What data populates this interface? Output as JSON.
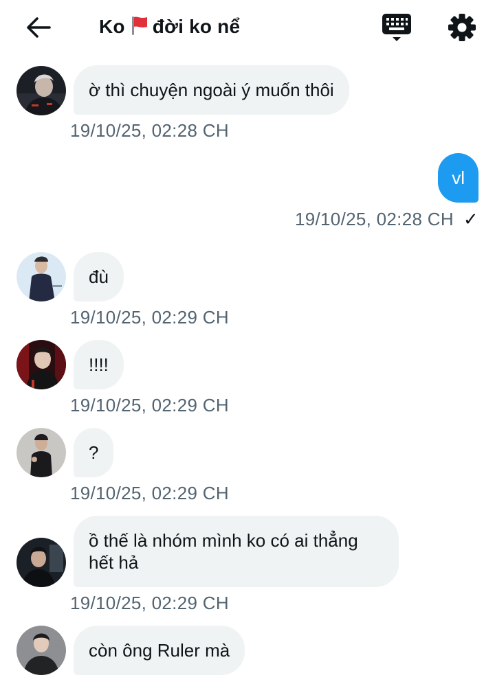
{
  "header": {
    "title_prefix": "Ko",
    "title_suffix": "đời ko nể",
    "back_icon": "arrow-left-icon",
    "flag_icon": "red-flag-emoji",
    "keyboard_icon": "keyboard-icon",
    "settings_icon": "gear-icon"
  },
  "messages": [
    {
      "text": "ờ thì chuyện ngoài ý muốn thôi",
      "time": "19/10/25, 02:28 CH"
    },
    {
      "text": "vl",
      "time": "19/10/25, 02:28 CH",
      "status": "✓"
    },
    {
      "text": "đù",
      "time": "19/10/25, 02:29 CH"
    },
    {
      "text": "!!!!",
      "time": "19/10/25, 02:29 CH"
    },
    {
      "text": "?",
      "time": "19/10/25, 02:29 CH"
    },
    {
      "text": "ồ thế là nhóm mình ko có ai thẳng hết hả",
      "time": "19/10/25, 02:29 CH"
    },
    {
      "text": "còn ông Ruler mà"
    }
  ],
  "colors": {
    "accent": "#1d9bf0",
    "incoming_bubble": "#eff3f4",
    "timestamp": "#536471",
    "text": "#0f1419"
  }
}
